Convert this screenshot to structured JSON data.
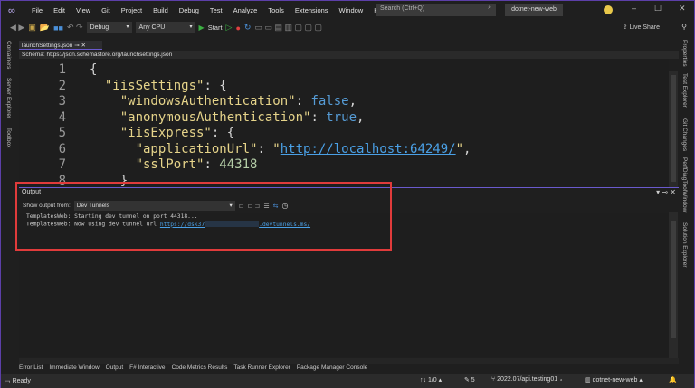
{
  "menu": [
    "File",
    "Edit",
    "View",
    "Git",
    "Project",
    "Build",
    "Debug",
    "Test",
    "Analyze",
    "Tools",
    "Extensions",
    "Window",
    "Help"
  ],
  "search": {
    "placeholder": "Search (Ctrl+Q)"
  },
  "solution_name": "dotnet-new-web",
  "toolbar": {
    "config": "Debug",
    "platform": "Any CPU",
    "start": "Start",
    "live_share": "Live Share"
  },
  "left_tabs": [
    "Containers",
    "Server Explorer",
    "Toolbox"
  ],
  "right_tabs": [
    "Properties",
    "Test Explorer",
    "Git Changes",
    "PerfDiagToolWindow",
    "Solution Explorer"
  ],
  "editor": {
    "tab": "launchSettings.json",
    "schema_label": "Schema:",
    "schema_url": "https://json.schemastore.org/launchsettings.json",
    "lines": [
      {
        "n": "1",
        "parts": [
          [
            "p",
            "{"
          ]
        ]
      },
      {
        "n": "2",
        "parts": [
          [
            "p",
            "  "
          ],
          [
            "k",
            "\"iisSettings\""
          ],
          [
            "p",
            ": {"
          ]
        ]
      },
      {
        "n": "3",
        "parts": [
          [
            "p",
            "    "
          ],
          [
            "k",
            "\"windowsAuthentication\""
          ],
          [
            "p",
            ": "
          ],
          [
            "b",
            "false"
          ],
          [
            "p",
            ","
          ]
        ]
      },
      {
        "n": "4",
        "parts": [
          [
            "p",
            "    "
          ],
          [
            "k",
            "\"anonymousAuthentication\""
          ],
          [
            "p",
            ": "
          ],
          [
            "b",
            "true"
          ],
          [
            "p",
            ","
          ]
        ]
      },
      {
        "n": "5",
        "parts": [
          [
            "p",
            "    "
          ],
          [
            "k",
            "\"iisExpress\""
          ],
          [
            "p",
            ": {"
          ]
        ]
      },
      {
        "n": "6",
        "parts": [
          [
            "p",
            "      "
          ],
          [
            "k",
            "\"applicationUrl\""
          ],
          [
            "p",
            ": "
          ],
          [
            "k",
            "\""
          ],
          [
            "u",
            "http://localhost:64249/"
          ],
          [
            "k",
            "\""
          ],
          [
            "p",
            ","
          ]
        ]
      },
      {
        "n": "7",
        "parts": [
          [
            "p",
            "      "
          ],
          [
            "k",
            "\"sslPort\""
          ],
          [
            "p",
            ": "
          ],
          [
            "n",
            "44318"
          ]
        ]
      },
      {
        "n": "8",
        "parts": [
          [
            "p",
            "    }"
          ]
        ]
      }
    ]
  },
  "output": {
    "title": "Output",
    "show_from_label": "Show output from:",
    "source": "Dev Tunnels",
    "line1": "TemplatesWeb: Starting dev tunnel on port 44318...",
    "line2_prefix": "TemplatesWeb: Now using dev tunnel url ",
    "line2_link_start": "https://dsk37",
    "line2_link_end": ".devtunnels.ms/"
  },
  "bottom_tabs": [
    "Error List",
    "Immediate Window",
    "Output",
    "F# Interactive",
    "Code Metrics Results",
    "Task Runner Explorer",
    "Package Manager Console"
  ],
  "status": {
    "ready": "Ready",
    "updown": "↑↓ 1/0 ▴",
    "edits": "✎ 5",
    "branch": "2022.07/api.testing01 ▴",
    "repo": "dotnet-new-web ▴"
  },
  "colors": {
    "accent": "#6a5acd",
    "highlight_box": "#e03b3b"
  }
}
